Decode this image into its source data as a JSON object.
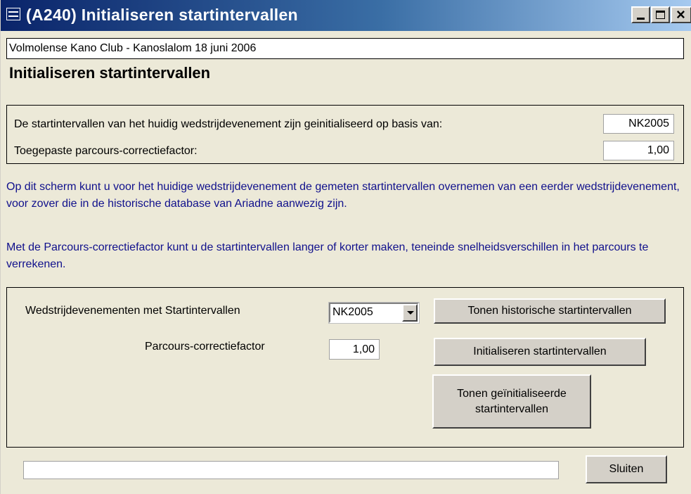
{
  "window": {
    "title": "(A240) Initialiseren startintervallen"
  },
  "header": {
    "event_name": "Volmolense Kano Club -  Kanoslalom 18 juni 2006",
    "page_title": "Initialiseren startintervallen"
  },
  "info": {
    "basis_label": "De startintervallen van het huidig wedstrijdevenement zijn geinitialiseerd op basis van:",
    "basis_value": "NK2005",
    "factor_label": "Toegepaste parcours-correctiefactor:",
    "factor_value": "1,00"
  },
  "help": {
    "paragraph1": "Op dit scherm kunt u voor het huidige wedstrijdevenement de gemeten startintervallen overnemen van een eerder wedstrijdevenement, voor zover die in de historische database van Ariadne aanwezig zijn.",
    "paragraph2": "Met de Parcours-correctiefactor kunt u de startintervallen langer of korter maken, teneinde snelheidsverschillen in het parcours te verrekenen."
  },
  "form": {
    "events_label": "Wedstrijdevenementen met Startintervallen",
    "events_selected": "NK2005",
    "factor_label": "Parcours-correctiefactor",
    "factor_value": "1,00"
  },
  "buttons": {
    "show_historic": "Tonen historische startintervallen",
    "initialize": "Initialiseren startintervallen",
    "show_initialized": "Tonen geïnitialiseerde startintervallen",
    "close": "Sluiten"
  },
  "icons": {
    "window_icon": "form-icon",
    "minimize": "minimize-icon",
    "maximize": "maximize-icon",
    "close": "close-icon",
    "dropdown": "chevron-down-icon"
  },
  "colors": {
    "title_bar_start": "#0a246a",
    "title_bar_end": "#a6caf0",
    "window_bg": "#ece9d8",
    "help_text": "#10108c"
  }
}
